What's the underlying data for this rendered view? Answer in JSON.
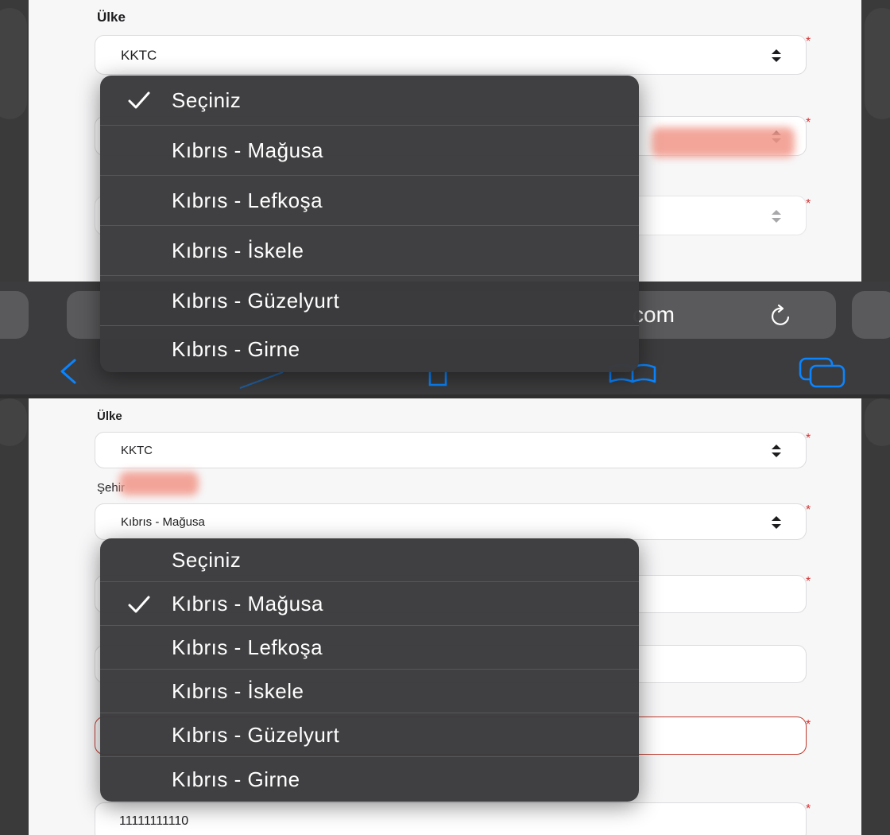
{
  "form": {
    "country_label": "Ülke",
    "country_value": "KKTC",
    "city_label": "Şehir",
    "city_value_bottom": "Kıbrıs - Mağusa",
    "phone_value": "11111111110",
    "required_mark": "*"
  },
  "browser": {
    "address_suffix": "com"
  },
  "dropdown": {
    "options": [
      "Seçiniz",
      "Kıbrıs - Mağusa",
      "Kıbrıs - Lefkoşa",
      "Kıbrıs - İskele",
      "Kıbrıs - Güzelyurt",
      "Kıbrıs - Girne"
    ],
    "selected_top": "Seçiniz",
    "selected_bottom": "Kıbrıs - Mağusa"
  },
  "icons": {
    "check": "check-icon",
    "select_arrows": "up-down-arrows-icon",
    "reload": "reload-icon",
    "back": "chevron-left-icon",
    "bookmarks": "book-icon",
    "tabs": "tabs-icon"
  },
  "colors": {
    "required": "#d93030",
    "error_border": "#c0392b",
    "dropdown_bg": "#3a3a3c",
    "accent_blue": "#0a84ff"
  }
}
